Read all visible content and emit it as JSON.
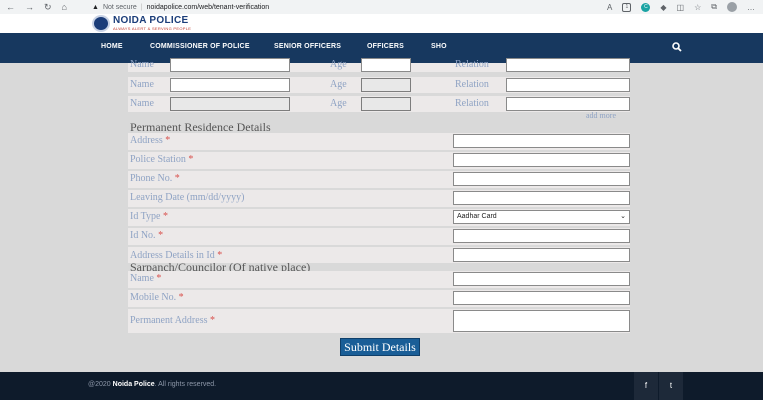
{
  "browser": {
    "security_label": "Not secure",
    "url": "noidapolice.com/web/tenant-verification"
  },
  "site": {
    "title": "NOIDA POLICE",
    "tagline": "ALWAYS ALERT & SERVING PEOPLE"
  },
  "nav": {
    "items": [
      "HOME",
      "COMMISSIONER OF POLICE",
      "SENIOR OFFICERS",
      "OFFICERS",
      "SHO"
    ]
  },
  "family": {
    "name_label": "Name",
    "age_label": "Age",
    "relation_label": "Relation",
    "add_more": "add more"
  },
  "permanent": {
    "title": "Permanent Residence Details",
    "fields": {
      "address": "Address",
      "police_station": "Police Station",
      "phone": "Phone No.",
      "leaving_date": "Leaving Date (mm/dd/yyyy)",
      "id_type": "Id Type",
      "id_no": "Id No.",
      "address_in_id": "Address Details in Id"
    },
    "id_type_value": "Aadhar Card"
  },
  "sarpanch": {
    "title": "Sarpanch/Councilor (Of native place)",
    "fields": {
      "name": "Name",
      "mobile": "Mobile No.",
      "address": "Permanent Address"
    }
  },
  "required_mark": "*",
  "submit_label": "Submit Details",
  "footer": {
    "year": "@2020",
    "brand": "Noida Police",
    "rights": ". All rights reserved.",
    "facebook": "f",
    "twitter": "t"
  }
}
